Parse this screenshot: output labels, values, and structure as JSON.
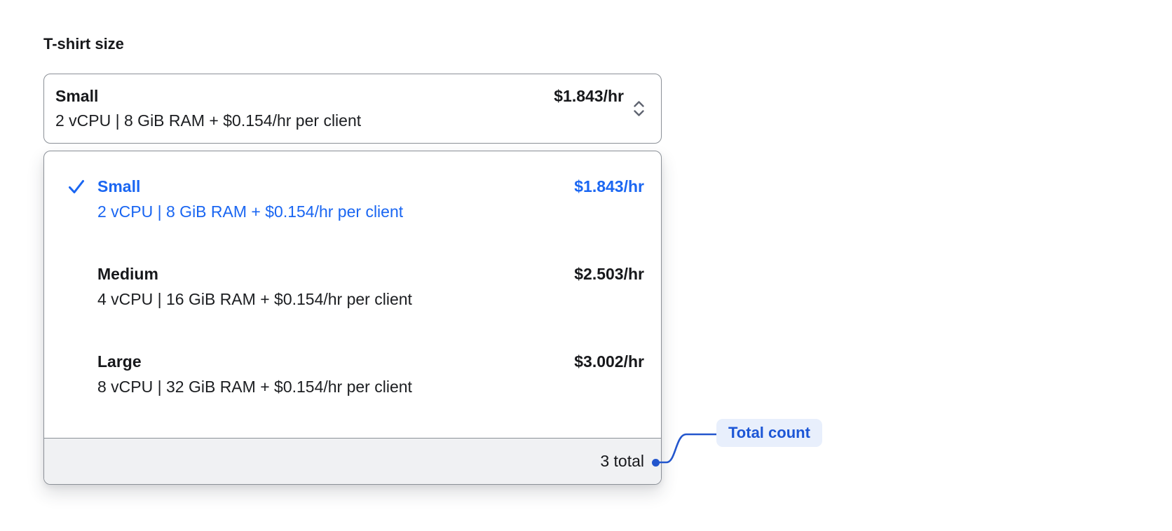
{
  "label": "T-shirt size",
  "select": {
    "selected_option": {
      "title": "Small",
      "subtitle": "2 vCPU | 8 GiB RAM + $0.154/hr per client",
      "price": "$1.843/hr"
    },
    "chevron_icon": "chevron-up-down"
  },
  "dropdown": {
    "options": [
      {
        "title": "Small",
        "subtitle": "2 vCPU | 8 GiB RAM + $0.154/hr per client",
        "price": "$1.843/hr",
        "selected": true
      },
      {
        "title": "Medium",
        "subtitle": "4 vCPU | 16 GiB RAM + $0.154/hr per client",
        "price": "$2.503/hr",
        "selected": false
      },
      {
        "title": "Large",
        "subtitle": "8 vCPU | 32 GiB RAM + $0.154/hr per client",
        "price": "$3.002/hr",
        "selected": false
      }
    ],
    "footer": {
      "total_label": "3 total"
    }
  },
  "annotation": {
    "label": "Total count"
  },
  "icons": {
    "check": "check-icon",
    "chevron": "chevron-up-down-icon"
  },
  "colors": {
    "selected_blue": "#1a66f2",
    "annotation_blue": "#2356cd",
    "annotation_text": "#1c56d6",
    "annotation_pill_bg": "#e8effc",
    "border_gray": "#8b9097",
    "footer_bg": "#f0f1f3",
    "text_dark": "#17181b",
    "chevron_gray": "#5f6470"
  }
}
